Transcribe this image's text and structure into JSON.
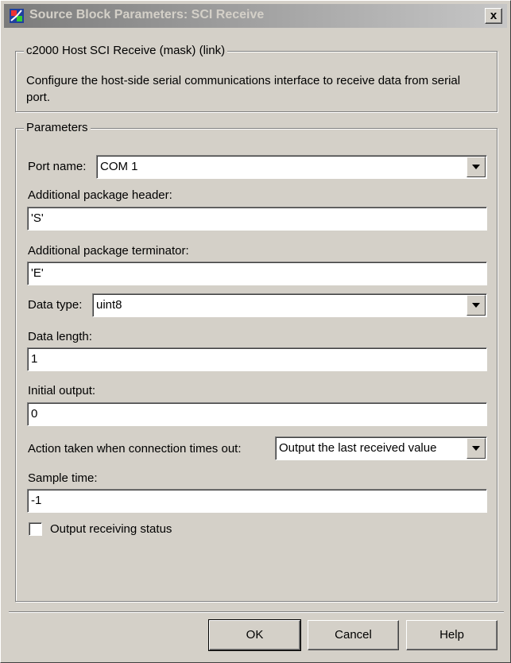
{
  "window": {
    "title": "Source Block Parameters: SCI Receive",
    "close_label": "x"
  },
  "description": {
    "group_title": "c2000 Host SCI Receive (mask) (link)",
    "text": "Configure the host-side serial communications interface to receive data from serial port."
  },
  "parameters": {
    "group_title": "Parameters",
    "port_name": {
      "label": "Port name:",
      "value": "COM 1"
    },
    "package_header": {
      "label": "Additional package header:",
      "value": "'S'"
    },
    "package_terminator": {
      "label": "Additional package terminator:",
      "value": "'E'"
    },
    "data_type": {
      "label": "Data type:",
      "value": "uint8"
    },
    "data_length": {
      "label": "Data length:",
      "value": "1"
    },
    "initial_output": {
      "label": "Initial output:",
      "value": "0"
    },
    "timeout_action": {
      "label": "Action taken when connection times out:",
      "value": "Output the last received value"
    },
    "sample_time": {
      "label": "Sample time:",
      "value": "-1"
    },
    "output_status": {
      "label": "Output receiving status",
      "checked": false
    }
  },
  "buttons": {
    "ok": "OK",
    "cancel": "Cancel",
    "help": "Help"
  },
  "icons": {
    "app_icon": "simulink-block-icon",
    "dropdown": "chevron-down-icon"
  }
}
